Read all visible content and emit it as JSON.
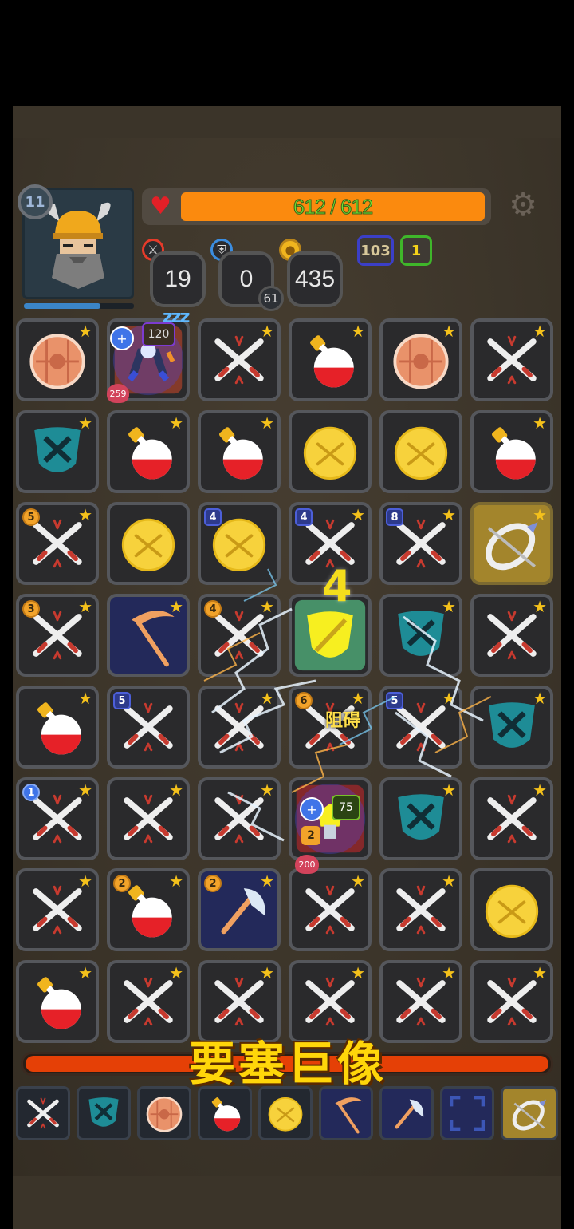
{
  "hero": {
    "level": "11",
    "hp_text": "612 / 612",
    "hp_fraction": 1.0,
    "xp_fraction": 0.7,
    "attack": "19",
    "armor": "0",
    "armor_sub": "61",
    "gold": "435",
    "chip_a": "103",
    "chip_b": "1"
  },
  "enemies": [
    {
      "attack_badge": "120",
      "health_badge": "259",
      "status": "zzz"
    },
    {
      "attack_badge": "75",
      "health_badge": "200",
      "counter": "2"
    }
  ],
  "combo": "4",
  "obstacle_label": "阻碍",
  "boss": {
    "name": "要塞巨像",
    "hp_fraction": 1.0
  },
  "colors": {
    "hp_fill": "#fb8a0e",
    "hp_text": "#6ee332",
    "boss_bar": "#e54006",
    "star": "#f4c11b",
    "accent_gold": "#ffd60a"
  },
  "grid": {
    "rows": [
      [
        {
          "t": "shield-round",
          "star": true
        },
        {
          "t": "enemy-robot",
          "star": false
        },
        {
          "t": "swords",
          "star": true
        },
        {
          "t": "potion",
          "star": true
        },
        {
          "t": "shield-round",
          "star": true
        },
        {
          "t": "swords",
          "star": true
        }
      ],
      [
        {
          "t": "shield-kite",
          "star": true
        },
        {
          "t": "potion",
          "star": true
        },
        {
          "t": "potion",
          "star": true
        },
        {
          "t": "coin",
          "star": false
        },
        {
          "t": "coin",
          "star": false
        },
        {
          "t": "potion",
          "star": true
        }
      ],
      [
        {
          "t": "swords",
          "star": true,
          "n": "5",
          "nc": "orange"
        },
        {
          "t": "coin",
          "star": false
        },
        {
          "t": "coin",
          "star": false,
          "n": "4"
        },
        {
          "t": "swords",
          "star": true,
          "n": "4"
        },
        {
          "t": "swords",
          "star": true,
          "n": "8"
        },
        {
          "t": "bow",
          "star": true,
          "bg": "gold"
        }
      ],
      [
        {
          "t": "swords",
          "star": true,
          "n": "3",
          "nc": "orange"
        },
        {
          "t": "scythe",
          "star": true,
          "bg": "blue"
        },
        {
          "t": "swords",
          "star": true,
          "n": "4",
          "nc": "orange"
        },
        {
          "t": "shield-gold",
          "star": false
        },
        {
          "t": "shield-kite",
          "star": true
        },
        {
          "t": "swords",
          "star": true
        }
      ],
      [
        {
          "t": "potion",
          "star": true
        },
        {
          "t": "swords",
          "star": false,
          "n": "5"
        },
        {
          "t": "swords",
          "star": true
        },
        {
          "t": "swords",
          "star": true,
          "n": "6",
          "nc": "orange"
        },
        {
          "t": "swords",
          "star": true,
          "n": "5"
        },
        {
          "t": "shield-kite",
          "star": true
        }
      ],
      [
        {
          "t": "swords",
          "star": true,
          "n": "1",
          "nc": "blue-round"
        },
        {
          "t": "swords",
          "star": true
        },
        {
          "t": "swords",
          "star": true
        },
        {
          "t": "enemy-bomb",
          "star": false
        },
        {
          "t": "shield-kite",
          "star": true
        },
        {
          "t": "swords",
          "star": true
        }
      ],
      [
        {
          "t": "swords",
          "star": true
        },
        {
          "t": "potion",
          "star": true,
          "n": "2",
          "nc": "orange"
        },
        {
          "t": "axe",
          "star": true,
          "bg": "blue",
          "n": "2",
          "nc": "orange"
        },
        {
          "t": "swords",
          "star": true
        },
        {
          "t": "swords",
          "star": true
        },
        {
          "t": "coin",
          "star": false
        }
      ],
      [
        {
          "t": "potion",
          "star": true
        },
        {
          "t": "swords",
          "star": true
        },
        {
          "t": "swords",
          "star": true
        },
        {
          "t": "swords",
          "star": true
        },
        {
          "t": "swords",
          "star": true
        },
        {
          "t": "swords",
          "star": true
        }
      ]
    ]
  },
  "slots": [
    {
      "icon": "swords-icon"
    },
    {
      "icon": "shield-kite-icon"
    },
    {
      "icon": "shield-round-icon"
    },
    {
      "icon": "potion-icon"
    },
    {
      "icon": "coin-icon"
    },
    {
      "icon": "scythe-icon",
      "bg": "blue"
    },
    {
      "icon": "axe-icon",
      "bg": "blue"
    },
    {
      "icon": "empty-slot-icon",
      "bg": "blue"
    },
    {
      "icon": "bow-icon",
      "bg": "gold"
    }
  ]
}
